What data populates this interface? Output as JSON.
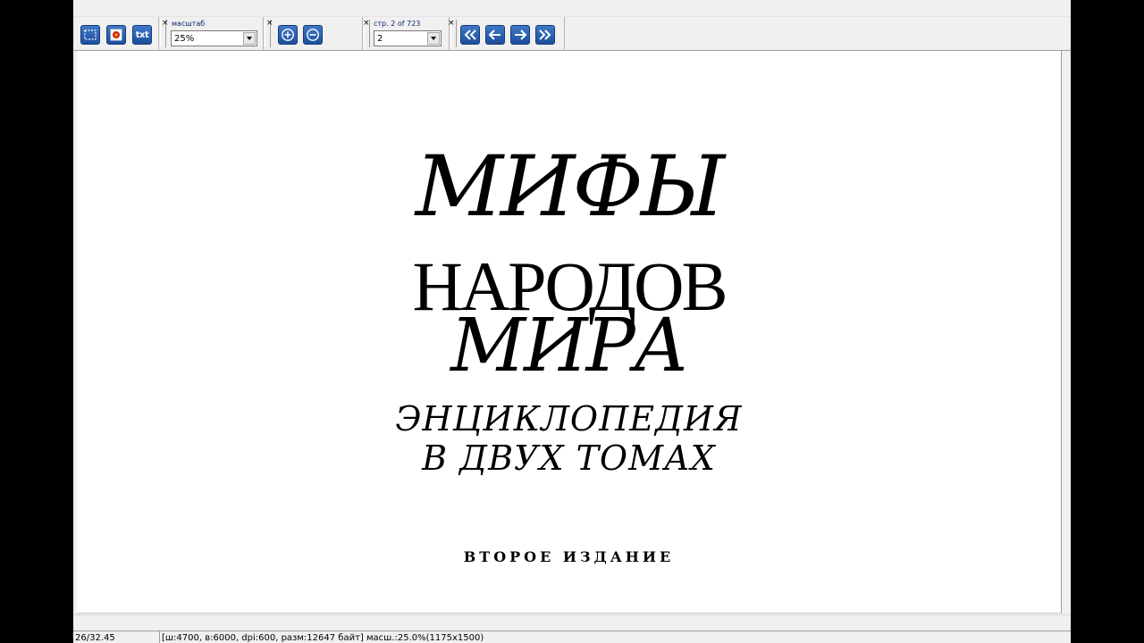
{
  "toolbar": {
    "tools": {
      "select_icon": "selection-rect-icon",
      "paint_icon": "color-picker-icon",
      "text_label": "txt"
    },
    "zoom": {
      "label": "масштаб",
      "value": "25%",
      "zoom_in_icon": "zoom-in-icon",
      "zoom_out_icon": "zoom-out-icon"
    },
    "pages": {
      "label": "стр. 2 of 723",
      "value": "2",
      "first_icon": "first-page-icon",
      "prev_icon": "prev-page-icon",
      "next_icon": "next-page-icon",
      "last_icon": "last-page-icon"
    },
    "close_glyph": "×"
  },
  "document": {
    "line1": "МИФЫ",
    "line2": "НАРОДОВ",
    "line3": "МИРА",
    "line4": "ЭНЦИКЛОПЕДИЯ",
    "line5": "В ДВУХ ТОМАХ",
    "edition": "ВТОРОЕ ИЗДАНИЕ"
  },
  "status": {
    "coords": "26/32.45",
    "info": "[ш:4700, в:6000, dpi:600, разм:12647 байт] масш.:25.0%(1175x1500)"
  },
  "colors": {
    "button_blue": "#2a5fae",
    "label_blue": "#0a246a"
  }
}
